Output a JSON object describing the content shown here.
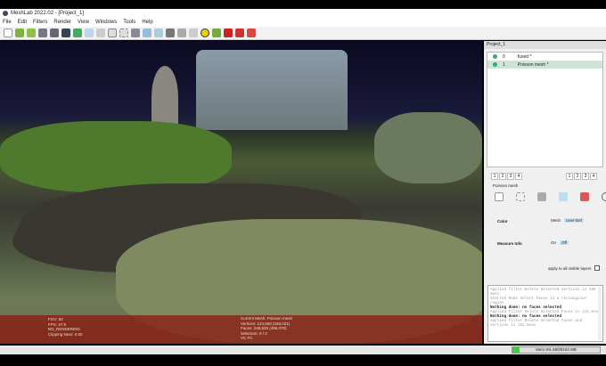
{
  "window": {
    "title": "MeshLab 2022.02 - [Project_1]"
  },
  "menu": [
    "File",
    "Edit",
    "Filters",
    "Render",
    "View",
    "Windows",
    "Tools",
    "Help"
  ],
  "toolbar_icons": [
    "new-icon",
    "open-icon",
    "save-icon",
    "import-icon",
    "export-icon",
    "snapshot-icon",
    "layers-icon",
    "points-icon",
    "wireframe-icon",
    "bbox-icon",
    "flat-icon",
    "smooth-icon",
    "texture-icon",
    "light-icon",
    "info-icon",
    "measure-icon",
    "align-icon",
    "select-icon",
    "paint-icon",
    "delete-icon"
  ],
  "panel": {
    "title": "Project_1",
    "layers": [
      {
        "id": "0",
        "name": "fused *"
      },
      {
        "id": "1",
        "name": "Poisson mesh *"
      }
    ],
    "view_buttons": [
      "1",
      "2",
      "3",
      "4"
    ],
    "section": "Poisson mesh",
    "color_label": "Color",
    "color_options": [
      "Mesh",
      "User-Def"
    ],
    "measure_label": "Measure Info",
    "measure_options": [
      "On",
      "Off"
    ],
    "apply_all": "apply to all visible layers"
  },
  "log": [
    {
      "t": "Applied filter Delete Selected Vertices in 106 msec",
      "b": false
    },
    {
      "t": "Started Mode Select Faces in a rectangular region",
      "b": false
    },
    {
      "t": "Nothing done: no faces selected",
      "b": true
    },
    {
      "t": "Applied filter Delete Selected Faces in 124 msec",
      "b": false
    },
    {
      "t": "Nothing done: no faces selected",
      "b": true
    },
    {
      "t": "Applied filter Delete Selected Faces and Vertices in 151 msec",
      "b": false
    }
  ],
  "overlay": {
    "left": [
      "FOV: 60",
      "FPS: 47.9",
      "BO_RENDERING",
      "Clipping Near: 0.00"
    ],
    "right": [
      "Current Mesh: Poisson mesh",
      "Vertices: 124,558 (248,021)",
      "Faces: 248,535 (496,070)",
      "Selection: 0 / 0",
      "VC FC"
    ]
  },
  "status": {
    "memory": "Mem 8% 680/8192 MB",
    "memory_fraction": 0.08
  }
}
